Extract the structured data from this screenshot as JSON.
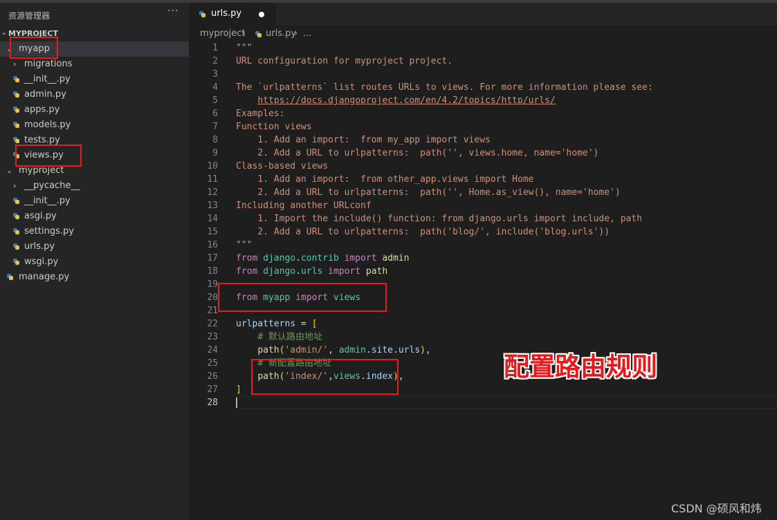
{
  "explorer": {
    "title": "资源管理器",
    "more": "···",
    "project": "MYPROJECT",
    "tree": [
      {
        "label": "myapp",
        "type": "folder",
        "expanded": true
      },
      {
        "label": "migrations",
        "type": "folder",
        "expanded": false
      },
      {
        "label": "__init__.py",
        "type": "python"
      },
      {
        "label": "admin.py",
        "type": "python"
      },
      {
        "label": "apps.py",
        "type": "python"
      },
      {
        "label": "models.py",
        "type": "python"
      },
      {
        "label": "tests.py",
        "type": "python"
      },
      {
        "label": "views.py",
        "type": "python"
      },
      {
        "label": "myproject",
        "type": "folder",
        "expanded": true
      },
      {
        "label": "__pycache__",
        "type": "folder",
        "expanded": false
      },
      {
        "label": "__init__.py",
        "type": "python"
      },
      {
        "label": "asgi.py",
        "type": "python"
      },
      {
        "label": "settings.py",
        "type": "python"
      },
      {
        "label": "urls.py",
        "type": "python"
      },
      {
        "label": "wsgi.py",
        "type": "python"
      },
      {
        "label": "manage.py",
        "type": "python"
      }
    ]
  },
  "tab": {
    "label": "urls.py",
    "unsaved": true
  },
  "breadcrumb": {
    "folder": "myproject",
    "file": "urls.py",
    "rest": "..."
  },
  "editor": {
    "line_numbers": [
      "1",
      "2",
      "3",
      "4",
      "5",
      "6",
      "7",
      "8",
      "9",
      "10",
      "11",
      "12",
      "13",
      "14",
      "15",
      "16",
      "17",
      "18",
      "19",
      "20",
      "21",
      "22",
      "23",
      "24",
      "25",
      "26",
      "27",
      "28"
    ],
    "current_line": 28,
    "lines": [
      "\"\"\"",
      "URL configuration for myproject project.",
      "",
      "The `urlpatterns` list routes URLs to views. For more information please see:",
      "    https://docs.djangoproject.com/en/4.2/topics/http/urls/",
      "Examples:",
      "Function views",
      "    1. Add an import:  from my_app import views",
      "    2. Add a URL to urlpatterns:  path('', views.home, name='home')",
      "Class-based views",
      "    1. Add an import:  from other_app.views import Home",
      "    2. Add a URL to urlpatterns:  path('', Home.as_view(), name='home')",
      "Including another URLconf",
      "    1. Import the include() function: from django.urls import include, path",
      "    2. Add a URL to urlpatterns:  path('blog/', include('blog.urls'))",
      "\"\"\"",
      "from django.contrib import admin",
      "from django.urls import path",
      "",
      "from myapp import views",
      "",
      "urlpatterns = [",
      "    # 默认路由地址",
      "    path('admin/', admin.site.urls),",
      "    # 新配置路由地址",
      "    path('index/',views.index),",
      "]",
      ""
    ]
  },
  "annotation": "配置路由规则",
  "watermark": "CSDN @硕风和炜",
  "colors": {
    "annotation_red": "#e0201f",
    "editor_bg": "#1e1e1e",
    "sidebar_bg": "#252526",
    "string": "#ce9178",
    "keyword": "#c586c0",
    "module": "#4ec9b0",
    "comment": "#6a9955"
  }
}
